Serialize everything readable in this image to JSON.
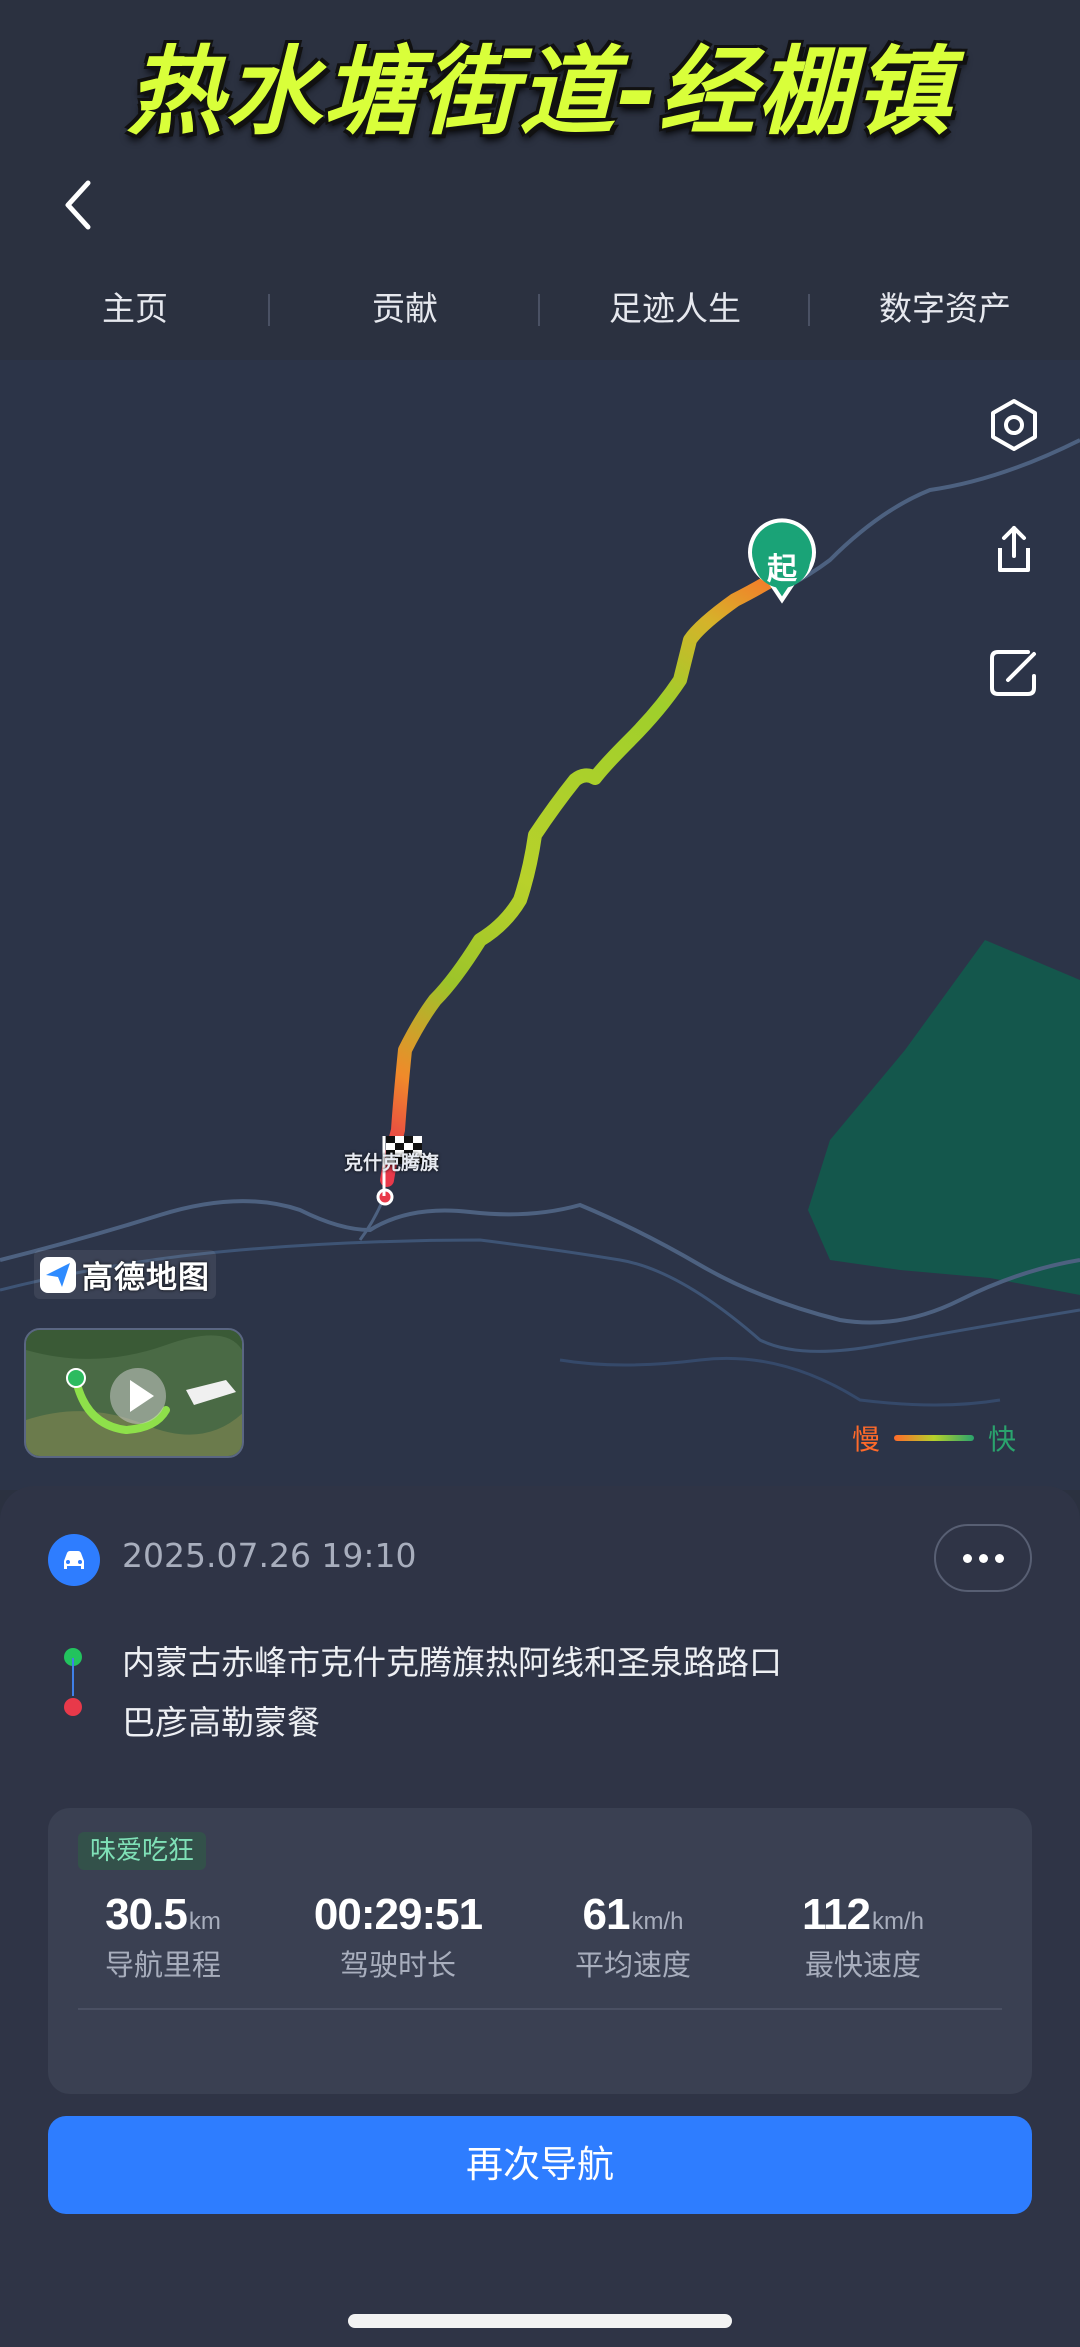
{
  "overlay": {
    "title": "热水塘街道-经棚镇"
  },
  "tabs": [
    {
      "label": "主页"
    },
    {
      "label": "贡献"
    },
    {
      "label": "足迹人生"
    },
    {
      "label": "数字资产"
    }
  ],
  "map": {
    "start_badge": "起",
    "end_place": "克什克腾旗",
    "logo_text": "高德地图",
    "legend": {
      "slow": "慢",
      "fast": "快"
    },
    "colors": {
      "slow": "#ff6a2a",
      "mid": "#b6d12b",
      "fast": "#2aa36d",
      "end": "#e8394a"
    }
  },
  "trip": {
    "datetime": "2025.07.26 19:10",
    "start_address": "内蒙古赤峰市克什克腾旗热阿线和圣泉路路口",
    "end_address": "巴彦高勒蒙餐",
    "tag": "味爱吃狂",
    "stats": [
      {
        "value": "30.5",
        "unit": "km",
        "label": "导航里程"
      },
      {
        "value": "00:29:51",
        "unit": "",
        "label": "驾驶时长"
      },
      {
        "value": "61",
        "unit": "km/h",
        "label": "平均速度"
      },
      {
        "value": "112",
        "unit": "km/h",
        "label": "最快速度"
      }
    ],
    "nav_again_label": "再次导航"
  },
  "accent": "#2e7dff"
}
